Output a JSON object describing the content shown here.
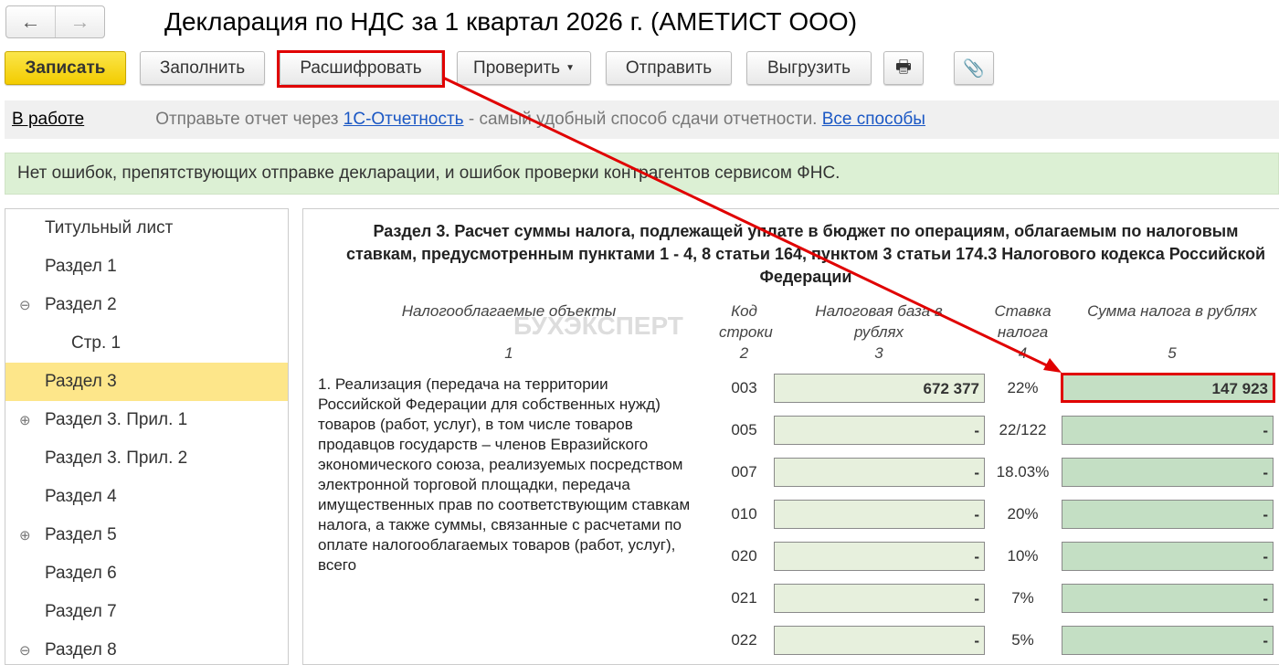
{
  "header": {
    "title": "Декларация по НДС за 1 квартал 2026 г. (АМЕТИСТ ООО)",
    "back": "←",
    "forward": "→"
  },
  "toolbar": {
    "save": "Записать",
    "fill": "Заполнить",
    "decode": "Расшифровать",
    "check": "Проверить",
    "send": "Отправить",
    "export": "Выгрузить"
  },
  "status": {
    "state": "В работе",
    "text1": "Отправьте отчет через",
    "link1": "1С-Отчетность",
    "text2": "- самый удобный способ сдачи отчетности.",
    "link2": "Все способы"
  },
  "message": "Нет ошибок, препятствующих отправке декларации, и ошибок проверки контрагентов сервисом ФНС.",
  "sidebar": [
    {
      "label": "Титульный лист",
      "toggle": ""
    },
    {
      "label": "Раздел 1",
      "toggle": ""
    },
    {
      "label": "Раздел 2",
      "toggle": "⊖"
    },
    {
      "label": "Стр. 1",
      "toggle": "",
      "indent": true
    },
    {
      "label": "Раздел 3",
      "toggle": "",
      "selected": true
    },
    {
      "label": "Раздел 3. Прил. 1",
      "toggle": "⊕"
    },
    {
      "label": "Раздел 3. Прил. 2",
      "toggle": ""
    },
    {
      "label": "Раздел 4",
      "toggle": ""
    },
    {
      "label": "Раздел 5",
      "toggle": "⊕"
    },
    {
      "label": "Раздел 6",
      "toggle": ""
    },
    {
      "label": "Раздел 7",
      "toggle": ""
    },
    {
      "label": "Раздел 8",
      "toggle": "⊖"
    }
  ],
  "section": {
    "title": "Раздел 3. Расчет суммы налога, подлежащей уплате в бюджет по операциям, облагаемым по налоговым ставкам, предусмотренным пунктами 1 - 4, 8 статьи 164, пунктом 3 статьи 174.3 Налогового кодекса Российской Федерации",
    "watermark": "БУХЭКСПЕРТ",
    "columns": [
      {
        "label": "Налогооблагаемые объекты",
        "num": "1"
      },
      {
        "label": "Код строки",
        "num": "2"
      },
      {
        "label": "Налоговая база в рублях",
        "num": "3"
      },
      {
        "label": "Ставка налога",
        "num": "4"
      },
      {
        "label": "Сумма налога в рублях",
        "num": "5"
      }
    ],
    "description": "1. Реализация (передача на территории Российской Федерации для собственных нужд) товаров (работ, услуг), в том числе товаров продавцов государств – членов Евразийского экономического союза, реализуемых посредством электронной торговой площадки, передача имущественных прав по соответствующим ставкам налога, а также суммы, связанные с расчетами по оплате налогооблагаемых товаров (работ, услуг), всего",
    "rows": [
      {
        "code": "003",
        "base": "672 377",
        "rate": "22%",
        "tax": "147 923"
      },
      {
        "code": "005",
        "base": "-",
        "rate": "22/122",
        "tax": "-"
      },
      {
        "code": "007",
        "base": "-",
        "rate": "18.03%",
        "tax": "-"
      },
      {
        "code": "010",
        "base": "-",
        "rate": "20%",
        "tax": "-"
      },
      {
        "code": "020",
        "base": "-",
        "rate": "10%",
        "tax": "-"
      },
      {
        "code": "021",
        "base": "-",
        "rate": "7%",
        "tax": "-"
      },
      {
        "code": "022",
        "base": "-",
        "rate": "5%",
        "tax": "-"
      }
    ]
  }
}
